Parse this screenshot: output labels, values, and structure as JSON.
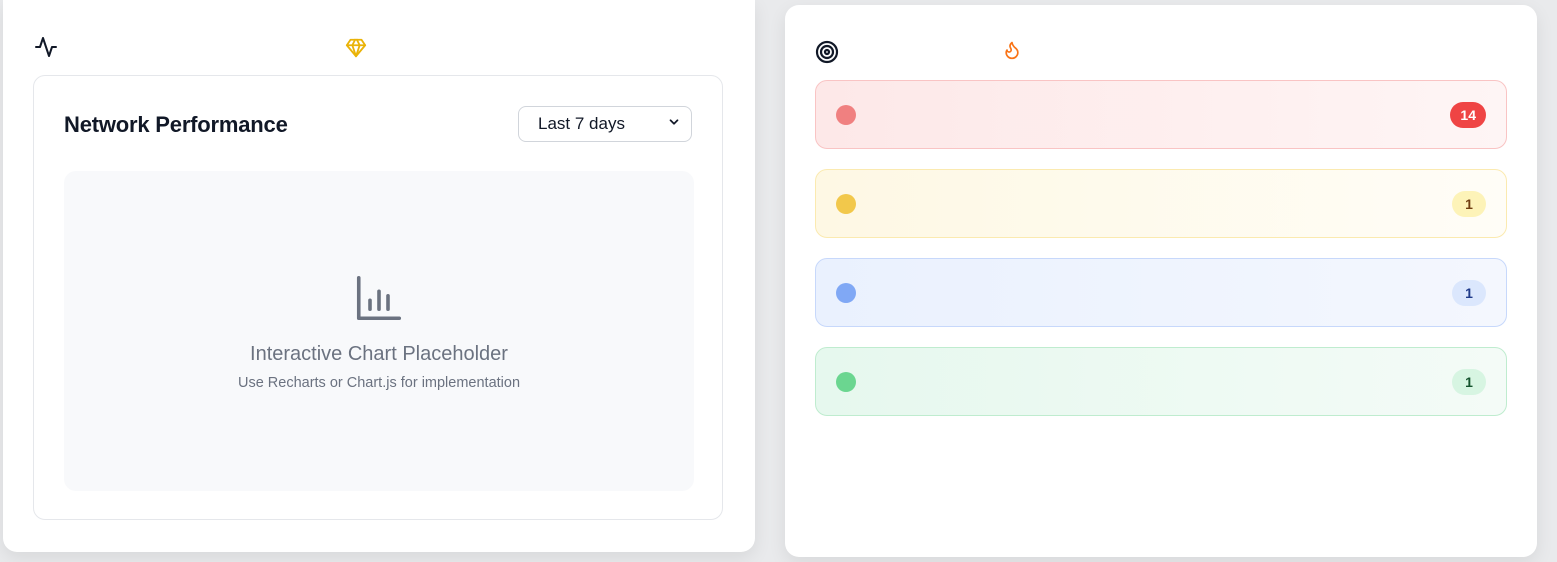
{
  "performance": {
    "title": "Network Performance",
    "range_select": {
      "value": "Last 7 days"
    },
    "chart_placeholder": {
      "title": "Interactive Chart Placeholder",
      "subtitle": "Use Recharts or Chart.js for implementation"
    }
  },
  "icons": {
    "left": [
      "activity-icon",
      "gem-icon"
    ],
    "right": [
      "target-icon",
      "flame-icon"
    ],
    "chart": "bar-chart-icon",
    "select": "chevron-down-icon"
  },
  "alerts": [
    {
      "color": "#ef4444",
      "count": "14"
    },
    {
      "color": "#eab308",
      "count": "1"
    },
    {
      "color": "#3b82f6",
      "count": "1"
    },
    {
      "color": "#22c55e",
      "count": "1"
    }
  ]
}
